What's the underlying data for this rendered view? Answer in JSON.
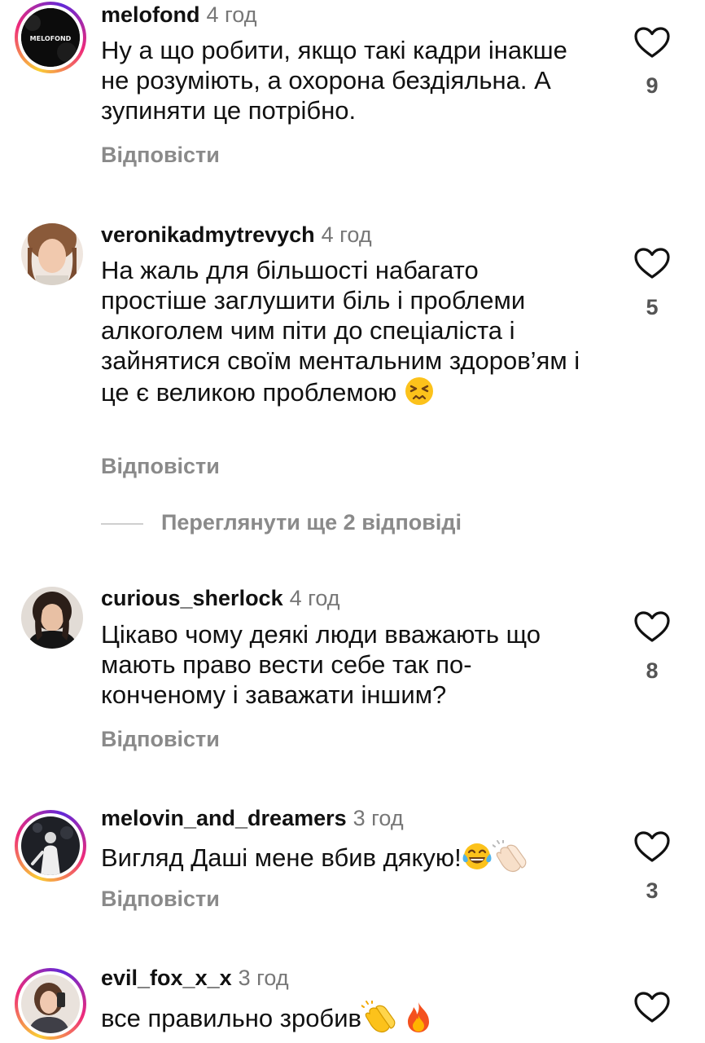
{
  "reply_label": "Відповісти",
  "view_more_replies": "Переглянути ще 2 відповіді",
  "comments": [
    {
      "username": "melofond",
      "time": "4 год",
      "avatar_text": "MELOFOND",
      "text": "Ну а що робити, якщо такі кадри інакше не розуміють, а охорона бездіяльна. А зупиняти це потрібно.",
      "likes": "9"
    },
    {
      "username": "veronikadmytrevych",
      "time": "4 год",
      "text": "На жаль для більшості набагато простіше заглушити біль і проблеми алкоголем чим піти до спеціаліста і зайнятися своїм ментальним здоров’ям і це є великою проблемою",
      "likes": "5"
    },
    {
      "username": "curious_sherlock",
      "time": "4 год",
      "text": "Цікаво чому деякі люди вважають що мають право вести себе так по-конченому і заважати іншим?",
      "likes": "8"
    },
    {
      "username": "melovin_and_dreamers",
      "time": "3 год",
      "text": "Вигляд Даші мене вбив дякую!",
      "likes": "3"
    },
    {
      "username": "evil_fox_x_x",
      "time": "3 год",
      "text": "все правильно зробив"
    }
  ]
}
